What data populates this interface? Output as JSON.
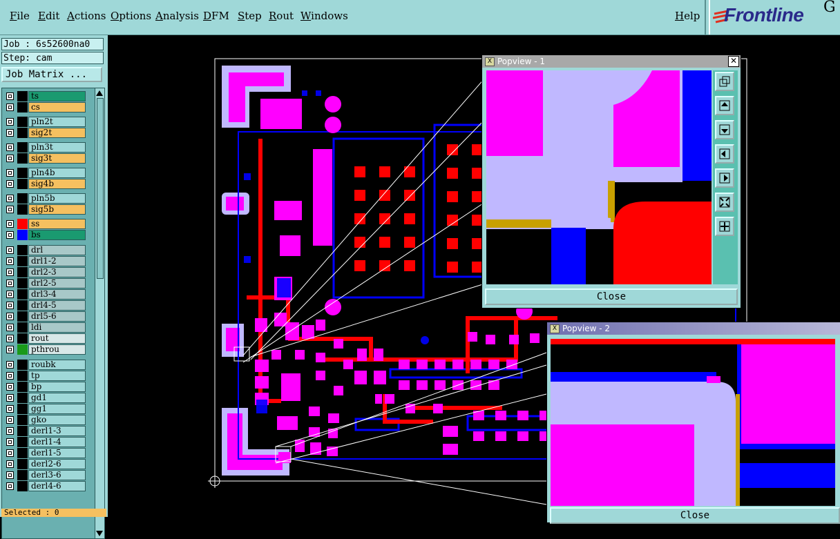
{
  "menubar": {
    "items": [
      "File",
      "Edit",
      "Actions",
      "Options",
      "Analysis",
      "DFM",
      "Step",
      "Rout",
      "Windows"
    ],
    "help": "Help"
  },
  "logo": {
    "text": "Frontline",
    "trailing": "G"
  },
  "info": {
    "job": "Job : 6s52600na0",
    "step": "Step: cam"
  },
  "job_matrix_label": "Job Matrix ...",
  "layers": [
    {
      "name": "ts",
      "color": "#1a9a70"
    },
    {
      "name": "cs",
      "color": "#f5c060"
    },
    {
      "name": "pln2t",
      "color": "#9fd8d8"
    },
    {
      "name": "sig2t",
      "color": "#f5c060"
    },
    {
      "name": "pln3t",
      "color": "#9fd8d8"
    },
    {
      "name": "sig3t",
      "color": "#f5c060"
    },
    {
      "name": "pln4b",
      "color": "#9fd8d8"
    },
    {
      "name": "sig4b",
      "color": "#f5c060"
    },
    {
      "name": "pln5b",
      "color": "#9fd8d8"
    },
    {
      "name": "sig5b",
      "color": "#f5c060"
    },
    {
      "name": "ss",
      "color": "#f5c060"
    },
    {
      "name": "bs",
      "color": "#1a9a70"
    },
    {
      "name": "drl",
      "color": "#a8c8c8"
    },
    {
      "name": "drl1-2",
      "color": "#a8c8c8"
    },
    {
      "name": "drl2-3",
      "color": "#a8c8c8"
    },
    {
      "name": "drl2-5",
      "color": "#a8c8c8"
    },
    {
      "name": "drl3-4",
      "color": "#a8c8c8"
    },
    {
      "name": "drl4-5",
      "color": "#a8c8c8"
    },
    {
      "name": "drl5-6",
      "color": "#a8c8c8"
    },
    {
      "name": "ldi",
      "color": "#a8c8c8"
    },
    {
      "name": "rout",
      "color": "#d8e8e8"
    },
    {
      "name": "pthrou",
      "color": "#d8e8e8"
    },
    {
      "name": "roubk",
      "color": "#9fd8d8"
    },
    {
      "name": "tp",
      "color": "#9fd8d8"
    },
    {
      "name": "bp",
      "color": "#9fd8d8"
    },
    {
      "name": "gd1",
      "color": "#9fd8d8"
    },
    {
      "name": "gg1",
      "color": "#9fd8d8"
    },
    {
      "name": "gko",
      "color": "#9fd8d8"
    },
    {
      "name": "derl1-3",
      "color": "#9fd8d8"
    },
    {
      "name": "derl1-4",
      "color": "#9fd8d8"
    },
    {
      "name": "derl1-5",
      "color": "#9fd8d8"
    },
    {
      "name": "derl2-6",
      "color": "#9fd8d8"
    },
    {
      "name": "derl3-6",
      "color": "#9fd8d8"
    },
    {
      "name": "derl4-6",
      "color": "#9fd8d8"
    }
  ],
  "selected": "Selected : 0",
  "popview1": {
    "title": "Popview - 1",
    "close_label": "Close"
  },
  "popview2": {
    "title": "Popview - 2",
    "close_label": "Close"
  },
  "colors": {
    "menu_bg": "#9fd8d8",
    "copper_top": "#ff00ff",
    "copper_red": "#ff0000",
    "outline_blue": "#0000ff",
    "mask_lavender": "#c0b8ff",
    "gold": "#c8a000"
  }
}
